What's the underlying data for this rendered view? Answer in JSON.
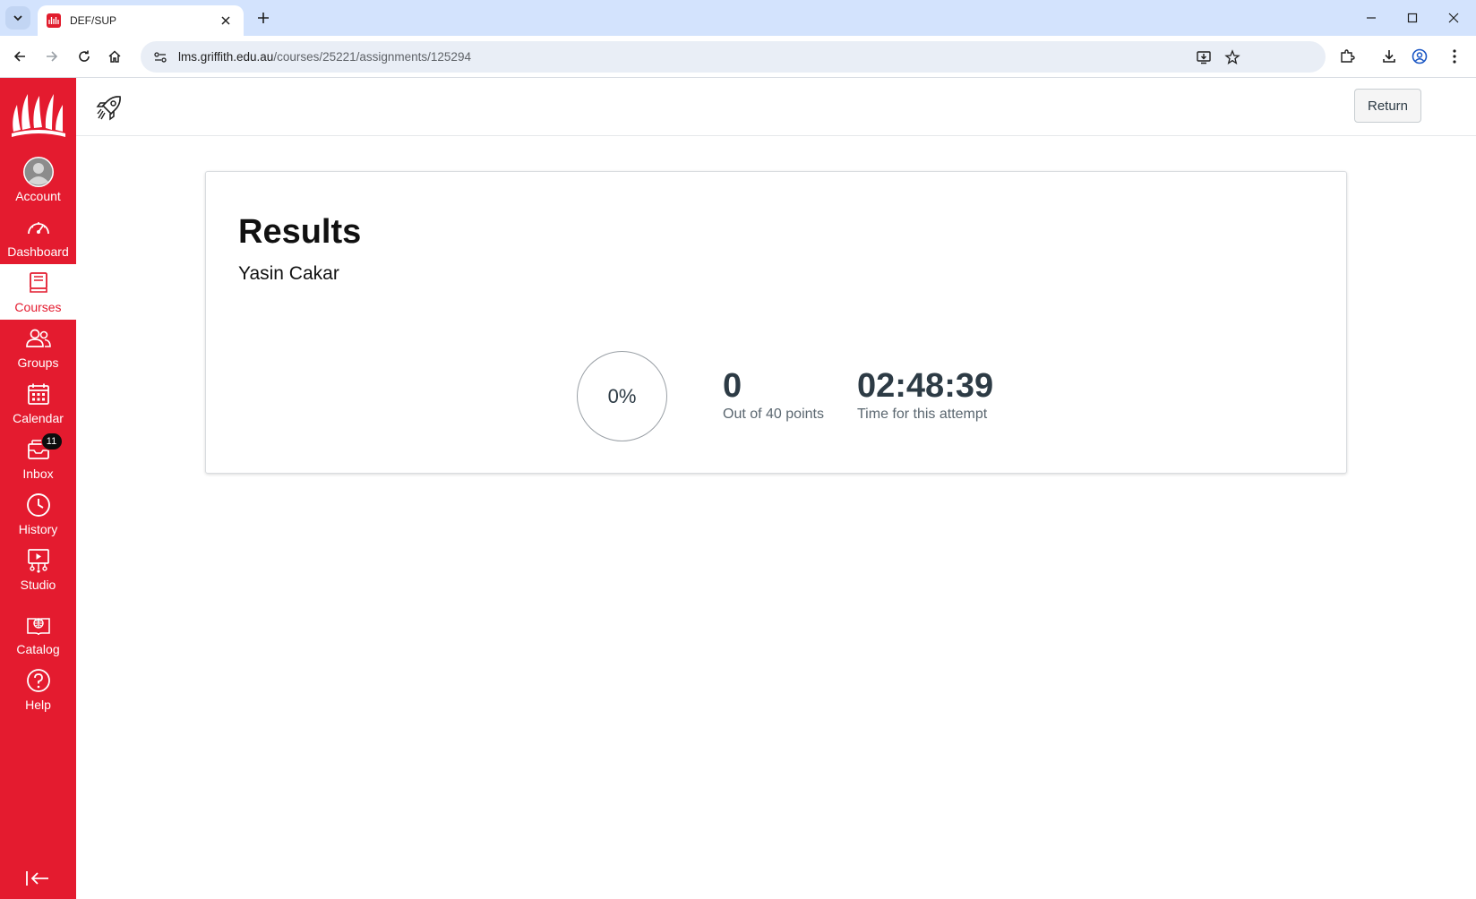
{
  "browser": {
    "tab_title": "DEF/SUP",
    "url_host": "lms.griffith.edu.au",
    "url_path": "/courses/25221/assignments/125294"
  },
  "sidebar": {
    "items": [
      {
        "label": "Account",
        "icon": "avatar-icon"
      },
      {
        "label": "Dashboard",
        "icon": "dashboard-icon"
      },
      {
        "label": "Courses",
        "icon": "book-icon"
      },
      {
        "label": "Groups",
        "icon": "groups-icon"
      },
      {
        "label": "Calendar",
        "icon": "calendar-icon"
      },
      {
        "label": "Inbox",
        "icon": "inbox-icon",
        "badge": "11"
      },
      {
        "label": "History",
        "icon": "clock-icon"
      },
      {
        "label": "Studio",
        "icon": "studio-icon"
      },
      {
        "label": "Catalog",
        "icon": "catalog-icon"
      },
      {
        "label": "Help",
        "icon": "help-icon"
      }
    ],
    "active": "Courses"
  },
  "topbar": {
    "return_label": "Return"
  },
  "results": {
    "title": "Results",
    "student_name": "Yasin Cakar",
    "percent": "0%",
    "score": "0",
    "score_label": "Out of 40 points",
    "time": "02:48:39",
    "time_label": "Time for this attempt"
  },
  "colors": {
    "brand_red": "#e41b2f",
    "text_dark": "#2d3b45",
    "browser_frame": "#d3e3fd"
  }
}
